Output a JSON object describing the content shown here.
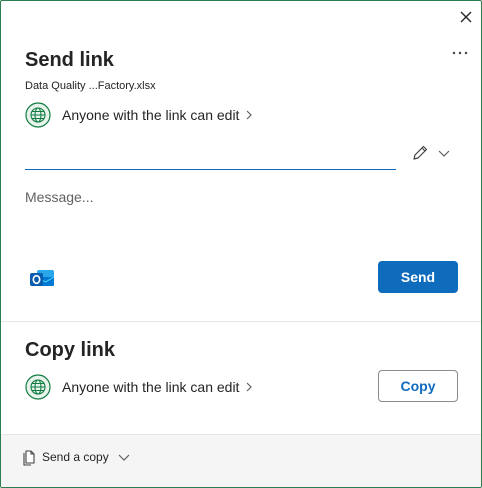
{
  "dialog": {
    "close_icon": "close-icon",
    "more_icon": "more-options-icon"
  },
  "send_link": {
    "title": "Send link",
    "file_name": "Data Quality ...Factory.xlsx",
    "permission": "Anyone with the link can edit",
    "to_value": "",
    "message_placeholder": "Message...",
    "send_label": "Send",
    "outlook_icon": "outlook-icon"
  },
  "copy_link": {
    "title": "Copy link",
    "permission": "Anyone with the link can edit",
    "copy_label": "Copy"
  },
  "footer": {
    "send_copy_label": "Send a copy"
  },
  "colors": {
    "accent": "#0f6cbd",
    "globe_green": "#107c41",
    "dialog_border": "#2e7d4f",
    "footer_bg": "#f5f5f5"
  }
}
